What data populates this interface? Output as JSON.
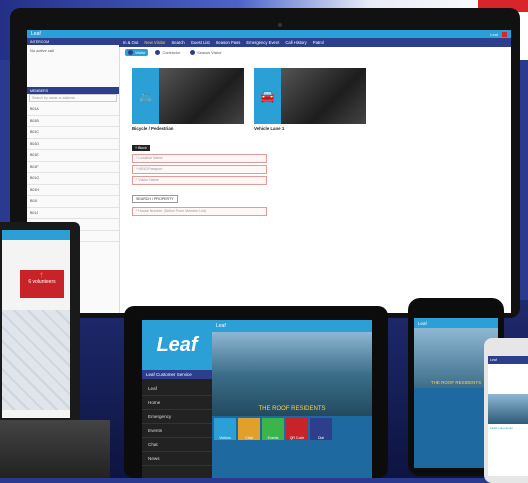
{
  "app": {
    "name": "Leaf",
    "titlebar_right": "Leaf",
    "nav": [
      "In & Out",
      "New Visitor",
      "Search",
      "Guest List",
      "Season Pass",
      "Emergency Event",
      "Call History",
      "Patrol"
    ],
    "active_nav": "New Visitor"
  },
  "sidebar": {
    "header": "INTERCOM",
    "header_right": "",
    "empty_text": "No active call",
    "residents_header": "MEMBERS",
    "search_placeholder": "Search by name or address",
    "items": [
      "B01A",
      "B01B",
      "B01C",
      "B01D",
      "B01E",
      "B01F",
      "B01G",
      "B01H",
      "B01I",
      "B01J",
      "B01K",
      "B01L"
    ]
  },
  "subtabs": [
    "Visitor",
    "Contractor",
    "Season Visitor"
  ],
  "cards": [
    {
      "label": "Bicycle / Pedestrian",
      "icon": "bicycle-icon",
      "glyph": "🚲"
    },
    {
      "label": "Vehicle Lane 1",
      "icon": "car-icon",
      "glyph": "🚘"
    }
  ],
  "form": {
    "top_button": "+ Block",
    "fields": [
      "* Location Name",
      "* NRIC/Passport",
      "* Visitor Name"
    ],
    "search_button": "SEARCH / PROPERTY",
    "house_field": "* House Number (Select From Member List)"
  },
  "laptop": {
    "card_text": "6 volunteers"
  },
  "tablet": {
    "brand": "Leaf",
    "brand_sub": "Leaf Customer Service",
    "menu": [
      "Leaf",
      "Home",
      "Emergency",
      "Events",
      "Chat",
      "News"
    ],
    "bar_title": "Leaf",
    "caption": "THE ROOF RESIDENTS",
    "tiles": [
      "Visitors",
      "Chat",
      "Events",
      "QR Code",
      "Dial"
    ]
  },
  "phone1": {
    "bar_title": "Leaf",
    "caption": "THE ROOF RESIDENTS"
  },
  "phone2": {
    "bar_title": "Leaf",
    "text": "LEAF community"
  },
  "colors": {
    "accent": "#2aa0d6",
    "navy": "#2d3e8c",
    "alert": "#c9232a"
  }
}
